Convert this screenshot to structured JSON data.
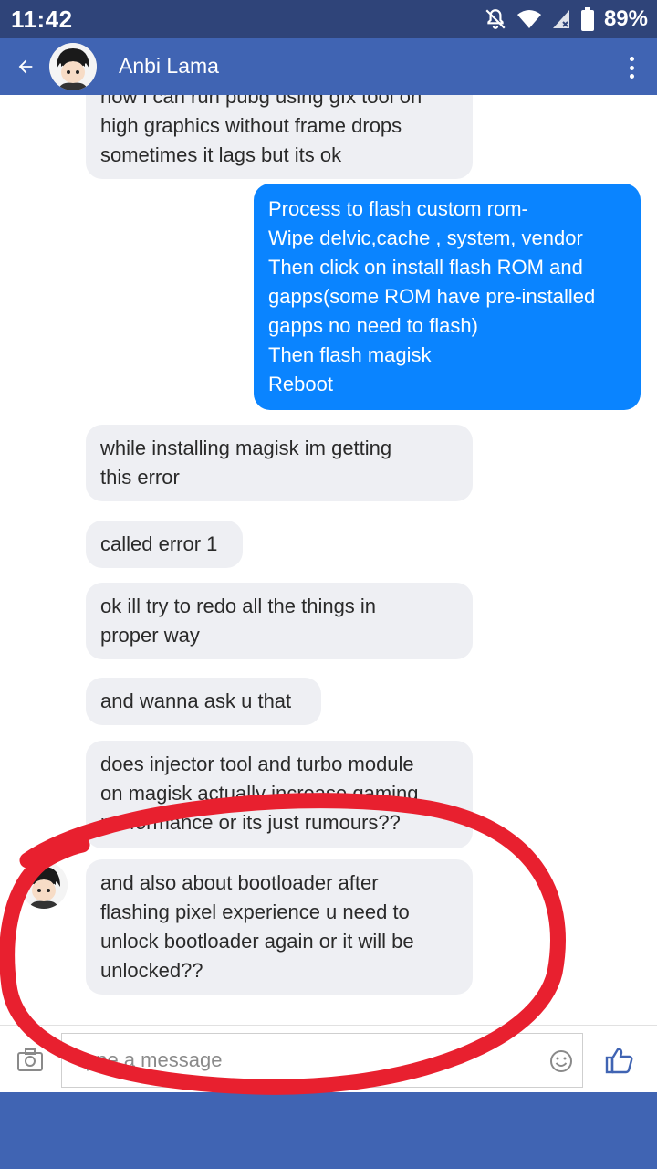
{
  "status_bar": {
    "time": "11:42",
    "battery": "89%",
    "icons": [
      "notifications-off-icon",
      "wifi-icon",
      "signal-icon",
      "battery-icon"
    ]
  },
  "header": {
    "contact_name": "Anbi Lama",
    "back_icon": "back-arrow-icon",
    "menu_icon": "more-vert-icon"
  },
  "messages": [
    {
      "direction": "in",
      "text": "now i can run pubg using gfx tool on\nhigh graphics without frame drops\nsometimes it lags but its ok"
    },
    {
      "direction": "out",
      "text": "Process to flash custom rom-\nWipe delvic,cache , system, vendor\nThen click on install flash ROM and\ngapps(some ROM have pre-installed\ngapps no need to flash)\nThen flash magisk\nReboot"
    },
    {
      "direction": "in",
      "text": "while installing magisk im getting\nthis error"
    },
    {
      "direction": "in",
      "text": "called error 1"
    },
    {
      "direction": "in",
      "text": "ok ill try to redo all the things in\nproper way"
    },
    {
      "direction": "in",
      "text": "and wanna ask u that"
    },
    {
      "direction": "in",
      "text": "does injector tool and turbo module\non magisk actually increase gaming\nperformance or its just rumours??"
    },
    {
      "direction": "in",
      "text": "and also about bootloader after\nflashing pixel experience u need to\nunlock bootloader again or it will be\nunlocked??"
    }
  ],
  "composer": {
    "placeholder": "Type a message",
    "camera_icon": "camera-icon",
    "emoji_icon": "emoji-icon",
    "like_icon": "thumbs-up-icon"
  },
  "colors": {
    "status_bar": "#2f4479",
    "app_bar": "#4064b3",
    "outgoing_bubble": "#0a84ff",
    "incoming_bubble": "#eeeff3",
    "annotation_circle": "#e8202f"
  }
}
